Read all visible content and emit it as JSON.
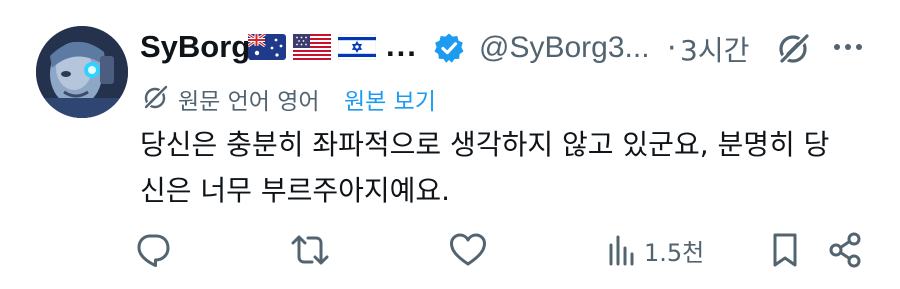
{
  "tweet": {
    "display_name": "SyBorg",
    "flags": [
      "australia-flag-icon",
      "usa-flag-icon",
      "israel-flag-icon"
    ],
    "name_ellipsis": "...",
    "handle": "@SyBorg3...",
    "separator": "·",
    "time": "3시간",
    "translation": {
      "label": "원문 언어 영어",
      "link": "원본 보기"
    },
    "body_lines": [
      "당신은 충분히 좌파적으로 생각하지 않고 있군요, 분명히 당",
      "신은 너무 부르주아지예요."
    ],
    "actions": {
      "views": "1.5천"
    }
  },
  "colors": {
    "text": "#0f1419",
    "muted": "#536471",
    "link": "#1d9bf0",
    "verified": "#1d9bf0"
  }
}
